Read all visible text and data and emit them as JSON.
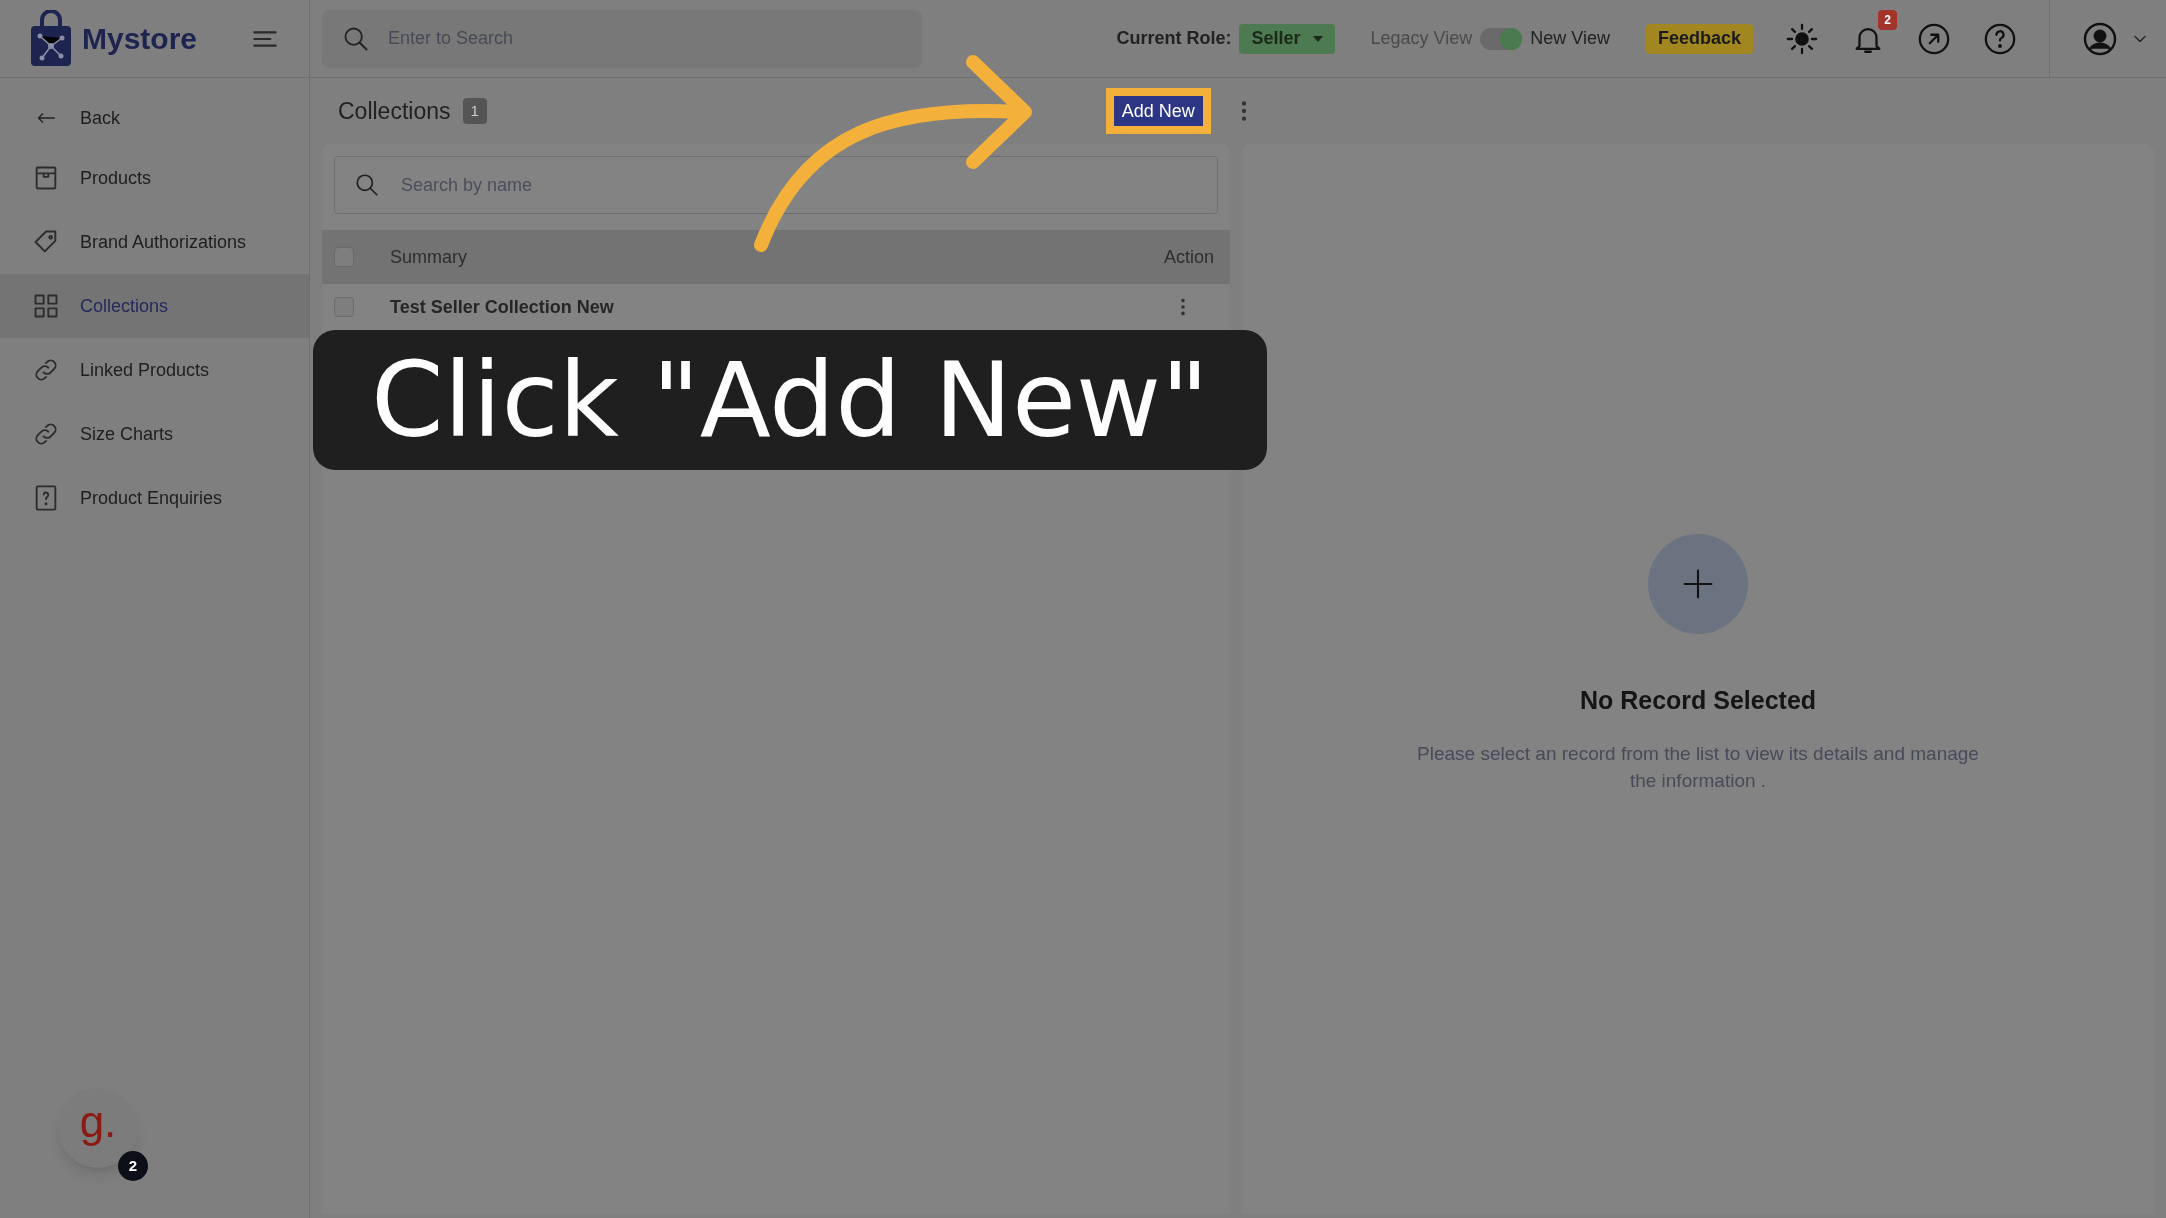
{
  "header": {
    "brand": "Mystore",
    "search": {
      "placeholder": "Enter to Search"
    },
    "role_label": "Current Role:",
    "role": "Seller",
    "view_toggle": {
      "left_label": "Legacy View",
      "right_label": "New View",
      "on": true
    },
    "feedback": "Feedback",
    "notifications": "2"
  },
  "sidebar": {
    "back": "Back",
    "items": [
      {
        "label": "Products",
        "selected": false
      },
      {
        "label": "Brand Authorizations",
        "selected": false
      },
      {
        "label": "Collections",
        "selected": true
      },
      {
        "label": "Linked Products",
        "selected": false
      },
      {
        "label": "Size Charts",
        "selected": false
      },
      {
        "label": "Product Enquiries",
        "selected": false
      }
    ]
  },
  "list": {
    "title": "Collections",
    "count": "1",
    "add_button": "Add New",
    "search": {
      "placeholder": "Search by name"
    },
    "columns": [
      "Summary",
      "Action"
    ],
    "header_checked": false,
    "rows": [
      {
        "summary": "Test Seller Collection New",
        "checked": false
      }
    ]
  },
  "detail": {
    "title": "No Record Selected",
    "message": "Please select an record from the list to view its details and manage the information ."
  },
  "chat_widget": {
    "letter": "g.",
    "badge": "2"
  },
  "tutorial": {
    "caption": "Click \"Add New\""
  }
}
